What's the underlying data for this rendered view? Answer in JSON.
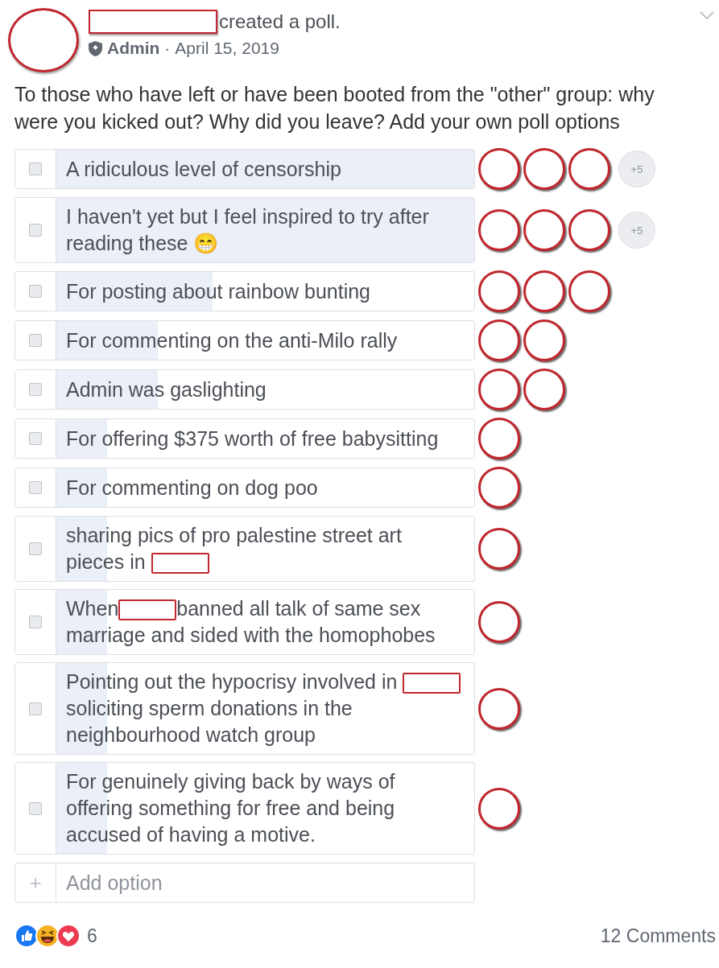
{
  "post": {
    "author_redacted": true,
    "action": "created a poll.",
    "role": "Admin",
    "separator": "·",
    "date": "April 15, 2019",
    "text": "To those who have left or have been booted from the \"other\" group: why were you kicked out? Why did you leave? Add your own poll options"
  },
  "options": [
    {
      "parts": [
        {
          "kind": "text",
          "text": "A ridiculous level of censorship"
        }
      ],
      "checked": false,
      "level": 1,
      "voters": [
        {
          "kind": "avatar"
        },
        {
          "kind": "avatar"
        },
        {
          "kind": "avatar"
        }
      ],
      "more_voters": "+5"
    },
    {
      "parts": [
        {
          "kind": "text",
          "text": "I haven't yet but I feel inspired to try after reading these 😁"
        }
      ],
      "checked": false,
      "level": 1,
      "voters": [
        {
          "kind": "avatar"
        },
        {
          "kind": "avatar"
        },
        {
          "kind": "avatar"
        }
      ],
      "more_voters": "+5"
    },
    {
      "parts": [
        {
          "kind": "text",
          "text": "For posting about rainbow bunting"
        }
      ],
      "checked": false,
      "level": 0.43,
      "voters": [
        {
          "kind": "avatar"
        },
        {
          "kind": "avatar"
        },
        {
          "kind": "avatar"
        }
      ]
    },
    {
      "parts": [
        {
          "kind": "text",
          "text": "For commenting on the anti-Milo rally"
        }
      ],
      "checked": false,
      "level": 0.31,
      "voters": [
        {
          "kind": "avatar"
        },
        {
          "kind": "avatar"
        }
      ]
    },
    {
      "parts": [
        {
          "kind": "text",
          "text": "Admin was gaslighting"
        }
      ],
      "checked": false,
      "level": 0.31,
      "voters": [
        {
          "kind": "avatar"
        },
        {
          "kind": "avatar"
        }
      ]
    },
    {
      "parts": [
        {
          "kind": "text",
          "text": "For offering $375 worth of free babysitting"
        }
      ],
      "checked": false,
      "level": 0.2,
      "voters": [
        {
          "kind": "avatar"
        }
      ]
    },
    {
      "parts": [
        {
          "kind": "text",
          "text": "For commenting on dog poo"
        }
      ],
      "checked": false,
      "level": 0.2,
      "voters": [
        {
          "kind": "avatar"
        }
      ]
    },
    {
      "parts": [
        {
          "kind": "text",
          "text": "sharing pics of pro palestine street art pieces in "
        },
        {
          "kind": "redaction"
        }
      ],
      "checked": false,
      "level": 0.2,
      "voters": [
        {
          "kind": "avatar"
        }
      ]
    },
    {
      "parts": [
        {
          "kind": "text",
          "text": "When"
        },
        {
          "kind": "redaction"
        },
        {
          "kind": "text",
          "text": "banned all talk of same sex marriage and sided with the homophobes"
        }
      ],
      "checked": false,
      "level": 0.2,
      "voters": [
        {
          "kind": "avatar"
        }
      ]
    },
    {
      "parts": [
        {
          "kind": "text",
          "text": "Pointing out the hypocrisy involved in "
        },
        {
          "kind": "redaction"
        },
        {
          "kind": "text",
          "text": " soliciting sperm donations in the neighbourhood watch group"
        }
      ],
      "checked": false,
      "level": 0.2,
      "voters": [
        {
          "kind": "avatar"
        }
      ]
    },
    {
      "parts": [
        {
          "kind": "text",
          "text": "For genuinely giving back by ways of offering something for free and being accused of having a motive."
        }
      ],
      "checked": false,
      "level": 0.2,
      "voters": [
        {
          "kind": "avatar"
        }
      ]
    }
  ],
  "add_option": {
    "icon": "+",
    "placeholder": "Add option"
  },
  "reactions": {
    "kinds": [
      {
        "kind": "like"
      },
      {
        "kind": "haha"
      },
      {
        "kind": "love"
      }
    ],
    "count": "6"
  },
  "comments": "12 Comments"
}
